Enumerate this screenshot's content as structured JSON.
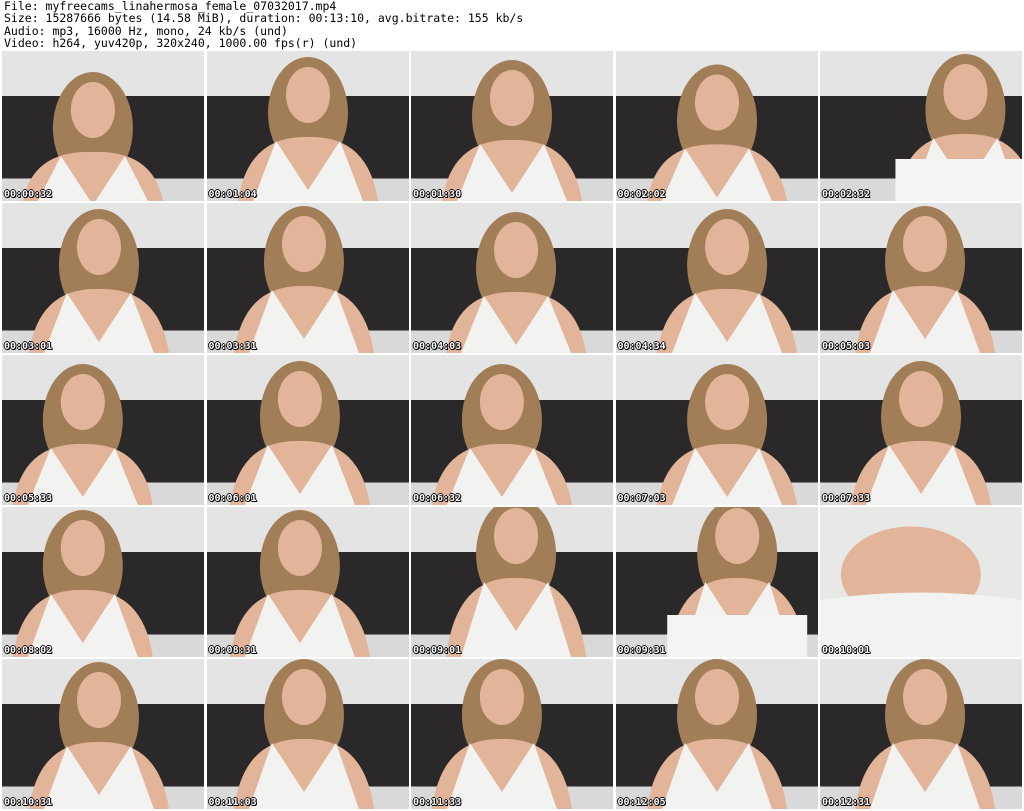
{
  "header": {
    "file_line": "File: myfreecams_linahermosa_female_07032017.mp4",
    "size_line": "Size: 15287666 bytes (14.58 MiB), duration: 00:13:10, avg.bitrate: 155 kb/s",
    "audio_line": "Audio: mp3, 16000 Hz, mono, 24 kb/s (und)",
    "video_line": "Video: h264, yuv420p, 320x240, 1000.00 fps(r) (und)"
  },
  "thumbnails": [
    {
      "timestamp": "00:00:32"
    },
    {
      "timestamp": "00:01:04"
    },
    {
      "timestamp": "00:01:30"
    },
    {
      "timestamp": "00:02:02"
    },
    {
      "timestamp": "00:02:32"
    },
    {
      "timestamp": "00:03:01"
    },
    {
      "timestamp": "00:03:31"
    },
    {
      "timestamp": "00:04:03"
    },
    {
      "timestamp": "00:04:34"
    },
    {
      "timestamp": "00:05:03"
    },
    {
      "timestamp": "00:05:33"
    },
    {
      "timestamp": "00:06:01"
    },
    {
      "timestamp": "00:06:32"
    },
    {
      "timestamp": "00:07:03"
    },
    {
      "timestamp": "00:07:33"
    },
    {
      "timestamp": "00:08:02"
    },
    {
      "timestamp": "00:08:31"
    },
    {
      "timestamp": "00:09:01"
    },
    {
      "timestamp": "00:09:31"
    },
    {
      "timestamp": "00:10:01"
    },
    {
      "timestamp": "00:10:31"
    },
    {
      "timestamp": "00:11:03"
    },
    {
      "timestamp": "00:11:33"
    },
    {
      "timestamp": "00:12:05"
    },
    {
      "timestamp": "00:12:31"
    }
  ],
  "colors": {
    "wall": "#e4e4e4",
    "sofa": "#2a2828",
    "dress": "#f2f2f0",
    "hair": "#a27e58",
    "skin": "#e2b59a"
  }
}
